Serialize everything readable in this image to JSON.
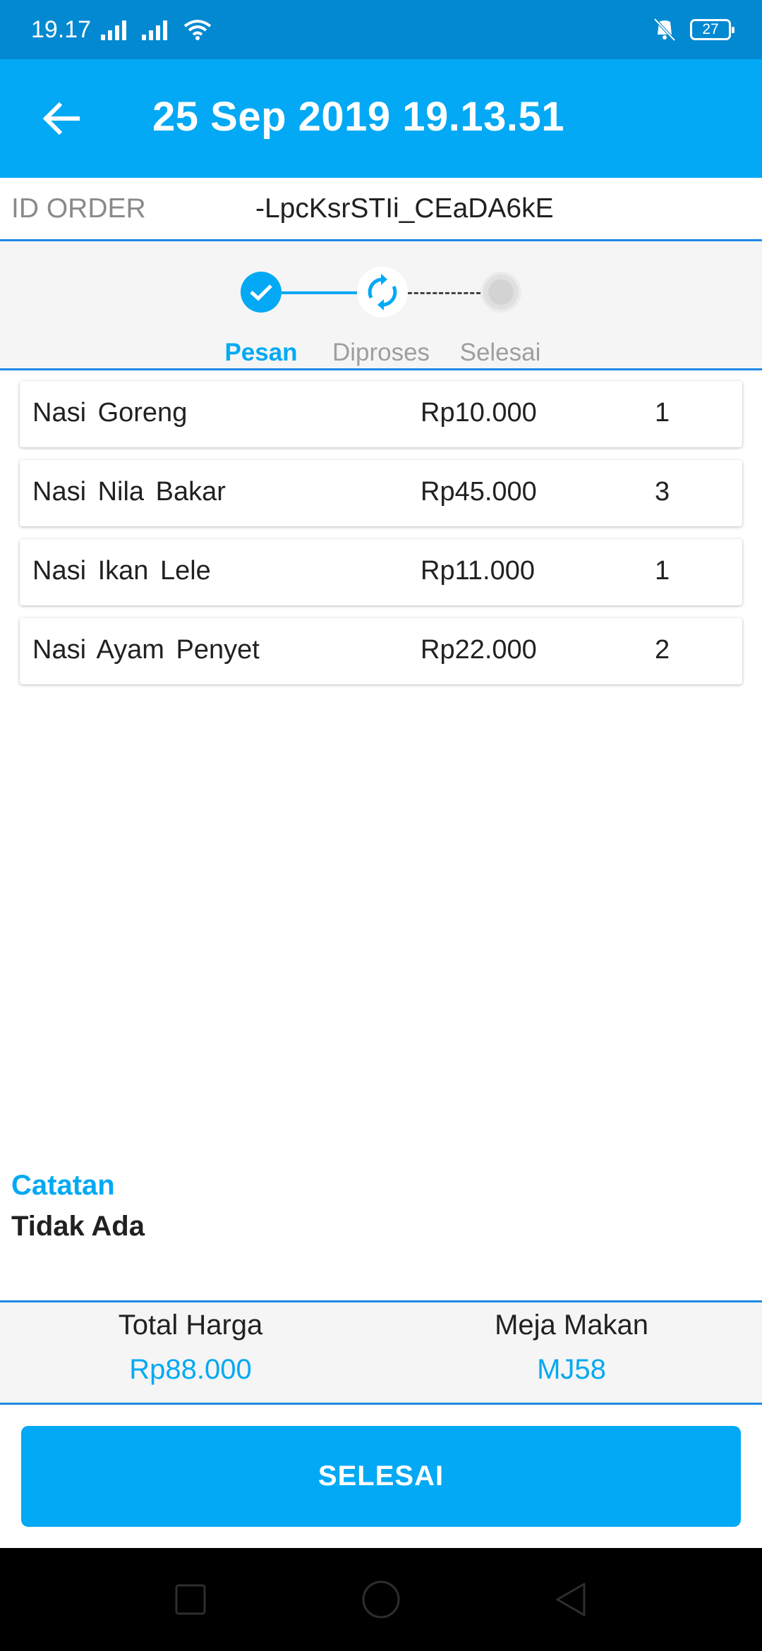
{
  "status_bar": {
    "time": "19.17",
    "battery": "27"
  },
  "app_bar": {
    "title": "25 Sep 2019 19.13.51"
  },
  "order": {
    "label": "ID ORDER",
    "id": "-LpcKsrSTIi_CEaDA6kE"
  },
  "stepper": {
    "steps": [
      {
        "label": "Pesan",
        "state": "done"
      },
      {
        "label": "Diproses",
        "state": "active"
      },
      {
        "label": "Selesai",
        "state": "pending"
      }
    ],
    "active_color": "#03a9f4",
    "inactive_color": "#9e9e9e"
  },
  "items": [
    {
      "name": "Nasi Goreng",
      "price": "Rp10.000",
      "qty": "1"
    },
    {
      "name": "Nasi Nila Bakar",
      "price": "Rp45.000",
      "qty": "3"
    },
    {
      "name": "Nasi Ikan Lele",
      "price": "Rp11.000",
      "qty": "1"
    },
    {
      "name": "Nasi Ayam Penyet",
      "price": "Rp22.000",
      "qty": "2"
    }
  ],
  "note": {
    "title": "Catatan",
    "value": "Tidak Ada"
  },
  "summary": {
    "total_label": "Total Harga",
    "total_value": "Rp88.000",
    "table_label": "Meja Makan",
    "table_value": "MJ58"
  },
  "actions": {
    "done_label": "SELESAI"
  },
  "icons": {
    "back": "arrow-back-icon",
    "step_done": "check-icon",
    "step_active": "refresh-icon",
    "step_pending": "radio-dot-icon",
    "nav_recents": "square-icon",
    "nav_home": "circle-icon",
    "nav_back": "triangle-back-icon"
  },
  "colors": {
    "primary": "#03a9f4",
    "status_bar": "#0289d1",
    "divider": "#1e88e5"
  }
}
